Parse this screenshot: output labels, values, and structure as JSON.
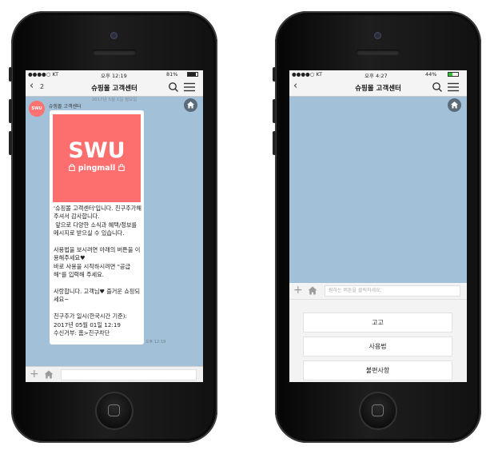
{
  "left_phone": {
    "status": {
      "carrier": "●●●●○ KT",
      "time": "오후 12:19",
      "battery": "81%",
      "battery_level": 0.81
    },
    "nav": {
      "back_count": "2",
      "title": "슈핑몰 고객센터"
    },
    "date_text": "2017년 5월 1일 월요일",
    "chat": {
      "sender": "슈핑몰 고객센터",
      "avatar_text": "SWU",
      "logo_main": "SWU",
      "logo_sub": "pingmall",
      "message": "'슈핑몰 고객센터'입니다. 친구추가해 주셔서 감사합니다.\n 앞으로 다양한 소식과 혜택/정보를 메시지로 받으실 수 있습니다.\n\n사용법을 보시려면 아래의 버튼을 이용해주세요♥\n바로 사용을 시작하시려면 \"공급해\"를 입력해 주세요.\n\n사랑합니다. 고객님♥ 즐거운 쇼핑되세요~\n\n친구추가 일시(한국시간 기준):\n2017년 05월 01일 12:19\n수신거부: 홈>친구차단",
      "time": "오후 12:19"
    },
    "input_placeholder": ""
  },
  "right_phone": {
    "status": {
      "carrier": "●●●●○ KT",
      "time": "오후 4:27",
      "battery": "44%",
      "battery_level": 0.44
    },
    "nav": {
      "title": "슈핑몰 고객센터"
    },
    "input_placeholder": "원하는 버튼을 클릭하세요.",
    "buttons": [
      "고고",
      "사용법",
      "불편사항"
    ]
  },
  "icons": [
    "back-chevron-icon",
    "search-icon",
    "menu-icon",
    "home-icon",
    "plus-icon"
  ]
}
